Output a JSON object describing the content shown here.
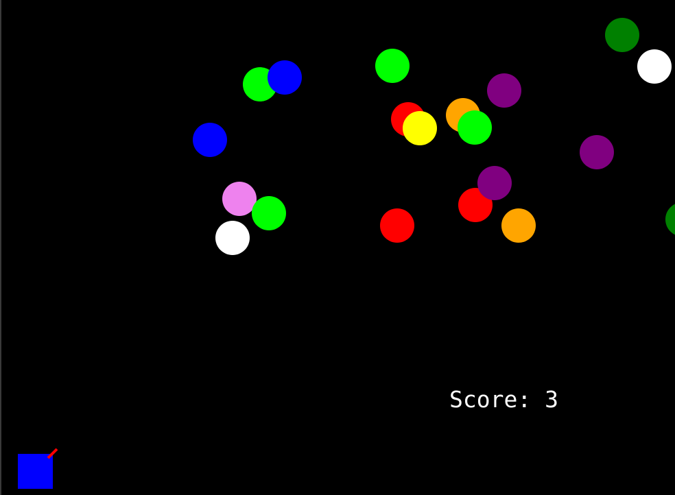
{
  "score": {
    "label": "Score: 3",
    "value": 3
  },
  "background_color": "#000000",
  "player": {
    "color": "#0000ff",
    "aim_color": "#ff0000"
  },
  "balls": [
    {
      "name": "ball-green-1",
      "color": "#00ff00"
    },
    {
      "name": "ball-blue-1",
      "color": "#0000ff"
    },
    {
      "name": "ball-green-2",
      "color": "#00ff00"
    },
    {
      "name": "ball-darkgreen-1",
      "color": "#008000"
    },
    {
      "name": "ball-white-1",
      "color": "#ffffff"
    },
    {
      "name": "ball-purple-1",
      "color": "#800080"
    },
    {
      "name": "ball-red-1",
      "color": "#ff0000"
    },
    {
      "name": "ball-yellow-1",
      "color": "#ffff00"
    },
    {
      "name": "ball-orange-1",
      "color": "#ffa500"
    },
    {
      "name": "ball-green-3",
      "color": "#00ff00"
    },
    {
      "name": "ball-blue-2",
      "color": "#0000ff"
    },
    {
      "name": "ball-purple-2",
      "color": "#800080"
    },
    {
      "name": "ball-violet-1",
      "color": "#ee82ee"
    },
    {
      "name": "ball-green-4",
      "color": "#00ff00"
    },
    {
      "name": "ball-white-2",
      "color": "#ffffff"
    },
    {
      "name": "ball-red-2",
      "color": "#ff0000"
    },
    {
      "name": "ball-red-3",
      "color": "#ff0000"
    },
    {
      "name": "ball-purple-3",
      "color": "#800080"
    },
    {
      "name": "ball-orange-2",
      "color": "#ffa500"
    },
    {
      "name": "ball-green-5",
      "color": "#008000"
    }
  ]
}
